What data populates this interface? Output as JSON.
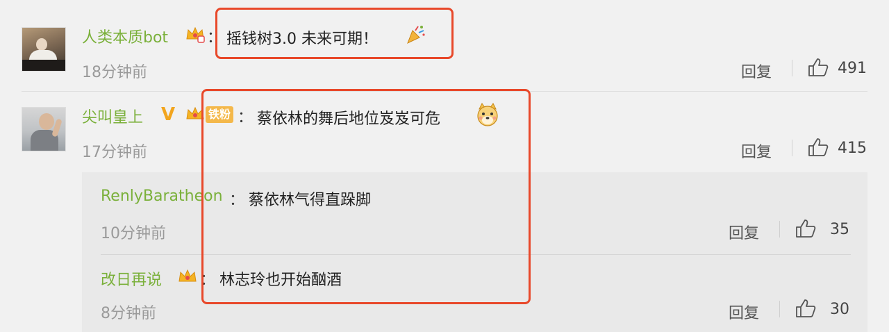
{
  "comments": [
    {
      "username": "人类本质bot",
      "content": "摇钱树3.0  未来可期！",
      "time": "18分钟前",
      "reply_label": "回复",
      "likes": "491"
    },
    {
      "username": "尖叫皇上",
      "badge_text": "铁粉",
      "content": "蔡依林的舞后地位岌岌可危",
      "time": "17分钟前",
      "reply_label": "回复",
      "likes": "415",
      "replies": [
        {
          "username": "RenlyBaratheon",
          "content": "蔡依林气得直跺脚",
          "time": "10分钟前",
          "reply_label": "回复",
          "likes": "35"
        },
        {
          "username": "改日再说",
          "content": "林志玲也开始酗酒",
          "time": "8分钟前",
          "reply_label": "回复",
          "likes": "30"
        }
      ]
    }
  ],
  "colon": "：",
  "colors": {
    "username": "#7ab03a",
    "highlight": "#e8482a",
    "badge": "#f4b84a",
    "background": "#f1f1f1",
    "reply_panel": "#e9e9e9"
  },
  "icons": [
    "thumb-up-icon",
    "crown-badge-icon",
    "verified-v-icon",
    "party-popper-icon",
    "dog-face-icon"
  ]
}
